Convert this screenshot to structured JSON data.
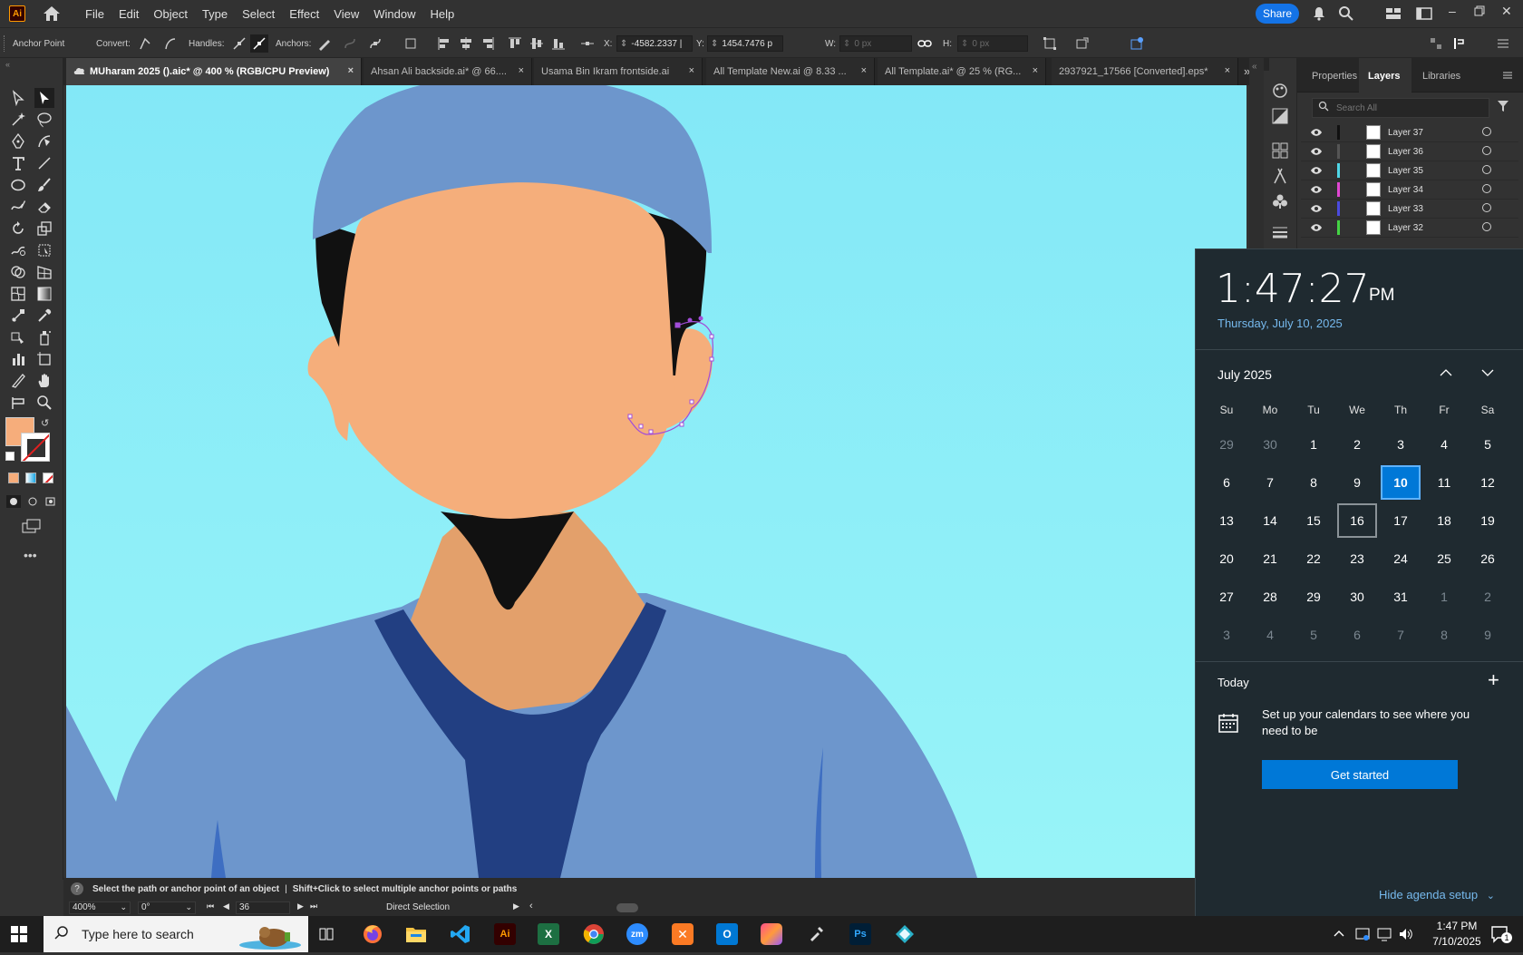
{
  "app": {
    "logo_text": "Ai"
  },
  "menu": [
    "File",
    "Edit",
    "Object",
    "Type",
    "Select",
    "Effect",
    "View",
    "Window",
    "Help"
  ],
  "share_label": "Share",
  "control_bar": {
    "tool_name": "Anchor Point",
    "convert_label": "Convert:",
    "handles_label": "Handles:",
    "anchors_label": "Anchors:",
    "x_label": "X:",
    "x_value": "-4582.2337 |",
    "y_label": "Y:",
    "y_value": "1454.7476 p",
    "w_label": "W:",
    "w_value": "0 px",
    "h_label": "H:",
    "h_value": "0 px"
  },
  "tabs": [
    {
      "label": "MUharam 2025 ().aic* @ 400 % (RGB/CPU Preview)",
      "close": "×",
      "active": true
    },
    {
      "label": "Ahsan Ali backside.ai* @ 66....",
      "close": "×",
      "active": false
    },
    {
      "label": "Usama Bin Ikram frontside.ai",
      "close": "×",
      "active": false
    },
    {
      "label": "All Template New.ai @ 8.33 ...",
      "close": "×",
      "active": false
    },
    {
      "label": "All Template.ai* @ 25 % (RG...",
      "close": "×",
      "active": false
    },
    {
      "label": "2937921_17566 [Converted].eps*",
      "close": "×",
      "active": false
    }
  ],
  "panel": {
    "tabs": [
      "Properties",
      "Layers",
      "Libraries"
    ],
    "active_tab": "Layers",
    "search_placeholder": "Search All",
    "layers": [
      {
        "name": "Layer 37",
        "color": "#111111"
      },
      {
        "name": "Layer 36",
        "color": "#555555"
      },
      {
        "name": "Layer 35",
        "color": "#4fd6e6"
      },
      {
        "name": "Layer 34",
        "color": "#e046d2"
      },
      {
        "name": "Layer 33",
        "color": "#4a4adf"
      },
      {
        "name": "Layer 32",
        "color": "#44d444"
      }
    ]
  },
  "status": {
    "hint": "Select the path or anchor point of an object",
    "separator": "|",
    "hint2": "Shift+Click to select multiple anchor points or paths",
    "zoom": "400%",
    "rotation": "0°",
    "artboard": "36",
    "tool": "Direct Selection"
  },
  "clock": {
    "time": "1:47:27",
    "ampm": "PM",
    "date": "Thursday, July 10, 2025",
    "month": "July 2025",
    "weekdays": [
      "Su",
      "Mo",
      "Tu",
      "We",
      "Th",
      "Fr",
      "Sa"
    ],
    "weeks": [
      [
        "29",
        "30",
        "1",
        "2",
        "3",
        "4",
        "5"
      ],
      [
        "6",
        "7",
        "8",
        "9",
        "10",
        "11",
        "12"
      ],
      [
        "13",
        "14",
        "15",
        "16",
        "17",
        "18",
        "19"
      ],
      [
        "20",
        "21",
        "22",
        "23",
        "24",
        "25",
        "26"
      ],
      [
        "27",
        "28",
        "29",
        "30",
        "31",
        "1",
        "2"
      ],
      [
        "3",
        "4",
        "5",
        "6",
        "7",
        "8",
        "9"
      ]
    ],
    "today_label": "Today",
    "plus": "+",
    "agenda_text": "Set up your calendars to see where you need to be",
    "get_started": "Get started",
    "hide_agenda": "Hide agenda setup"
  },
  "taskbar": {
    "search_placeholder": "Type here to search",
    "tray_time": "1:47 PM",
    "tray_date": "7/10/2025",
    "notification_count": "1"
  }
}
